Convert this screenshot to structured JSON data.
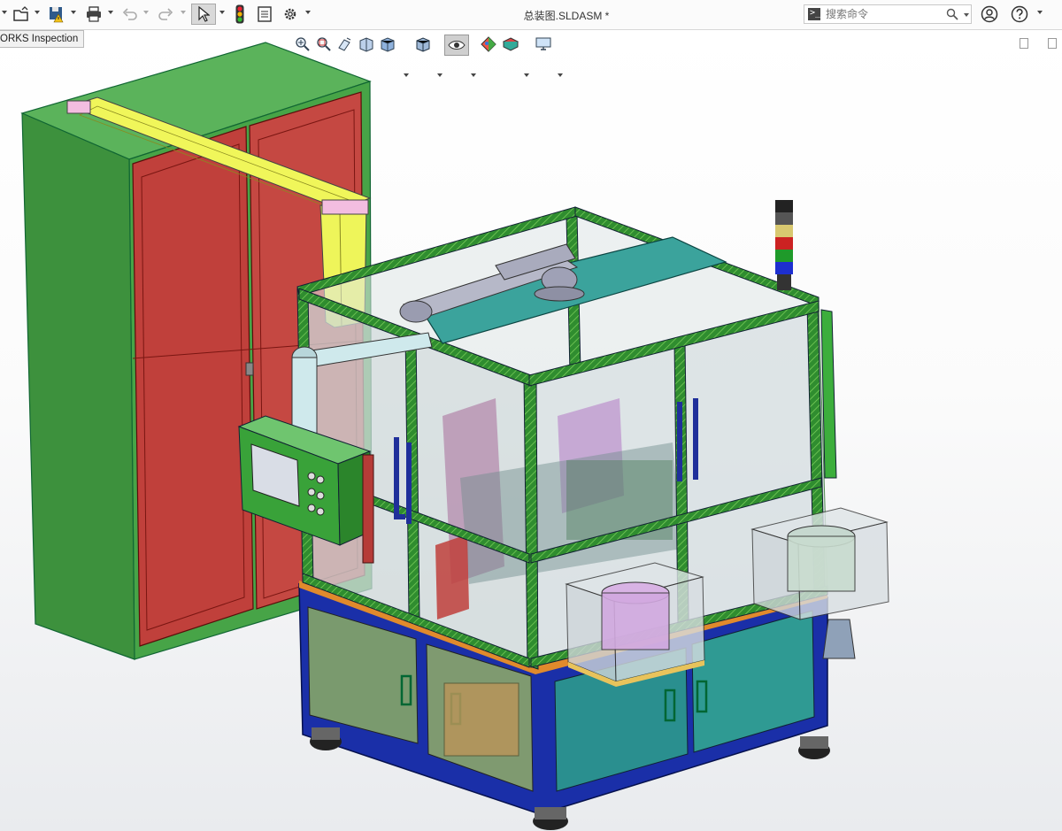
{
  "window": {
    "title": "总装图.SLDASM *"
  },
  "tooltip": {
    "text": "ORKS Inspection"
  },
  "search": {
    "placeholder": "搜索命令"
  },
  "toolbar": {
    "items": [
      "new-icon",
      "open-icon",
      "save-icon",
      "print-icon",
      "undo-icon",
      "redo-icon",
      "select-icon",
      "traffic-light-icon",
      "file-properties-icon",
      "options-gear-icon"
    ]
  },
  "headsup_toolbar": {
    "items": [
      "zoom-to-fit-icon",
      "zoom-area-icon",
      "previous-view-icon",
      "section-view-icon",
      "view-orientation-icon",
      "display-style-icon",
      "hide-show-items-icon",
      "edit-appearance-icon",
      "apply-scene-icon",
      "view-settings-icon"
    ]
  },
  "colors": {
    "cabinet_green": "#3a9a3a",
    "cabinet_door": "#b23b36",
    "gantry_yellow": "#eef55a",
    "frame_green": "#2f8d2f",
    "base_blue": "#1a2fa8",
    "panel_teal": "#2a8f8f",
    "glass": "#cfd9da"
  }
}
